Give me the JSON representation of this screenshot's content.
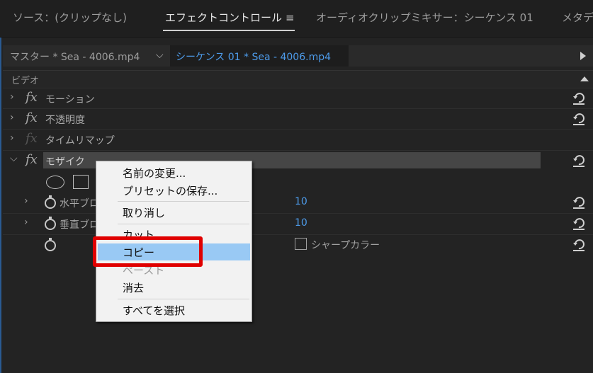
{
  "tabs": [
    {
      "label": "ソース：(クリップなし)",
      "active": false
    },
    {
      "label": "エフェクトコントロール",
      "active": true
    },
    {
      "label": "オーディオクリップミキサー：シーケンス 01",
      "active": false
    },
    {
      "label": "メタデ",
      "active": false
    }
  ],
  "tab_menu_icon": "hamburger-icon",
  "clip_bar": {
    "master": "マスター * Sea - 4006.mp4",
    "sequence": "シーケンス 01 * Sea - 4006.mp4",
    "chevron_icon": "chevron-down-icon",
    "play_icon": "play-triangle-icon"
  },
  "section_title": "ビデオ",
  "effects": [
    {
      "name": "モーション"
    },
    {
      "name": "不透明度"
    },
    {
      "name": "タイムリマップ"
    },
    {
      "name": "モザイク"
    }
  ],
  "mosaic_params": [
    {
      "name": "水平ブロ",
      "value": "10"
    },
    {
      "name": "垂直ブロ",
      "value": "10"
    }
  ],
  "sharp_color_label": "シャープカラー",
  "context_menu": {
    "items": [
      "名前の変更...",
      "プリセットの保存...",
      "取り消し",
      "カット",
      "コピー",
      "ペースト",
      "消去",
      "すべてを選択"
    ],
    "highlighted": "コピー",
    "disabled": [
      "ペースト"
    ]
  },
  "colors": {
    "accent_blue": "#4d9bea",
    "highlight": "#99c9f4",
    "callout_red": "#e00000",
    "panel_bg": "#232323"
  }
}
